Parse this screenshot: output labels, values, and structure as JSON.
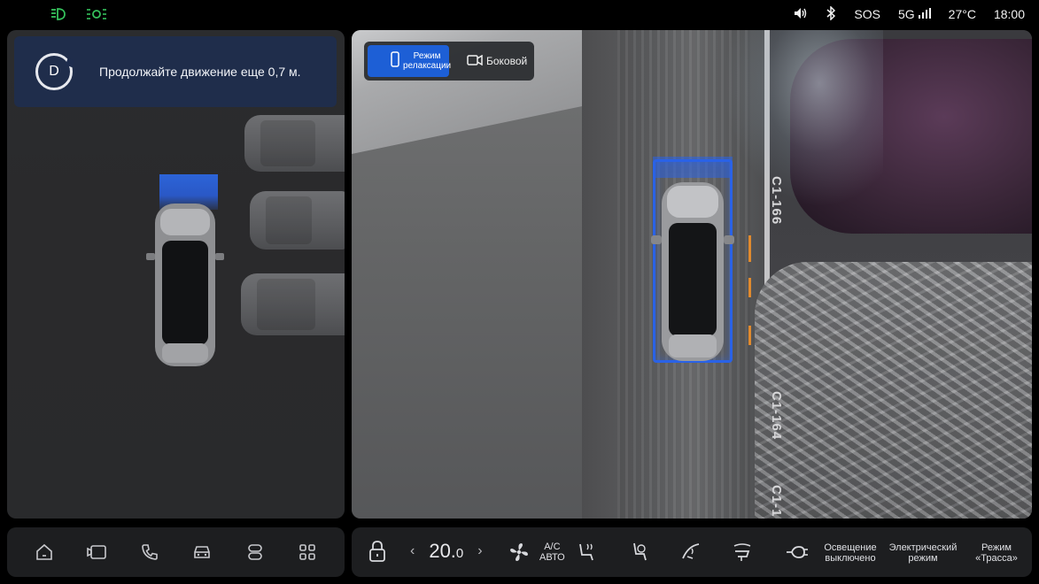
{
  "status_bar": {
    "sos": "SOS",
    "network": "5G",
    "temperature": "27°C",
    "time": "18:00",
    "left_icons": [
      "headlight-icon",
      "parking-light-icon"
    ],
    "accent_green": "#35c25c"
  },
  "notification": {
    "gear": "D",
    "message": "Продолжайте движение еще 0,7 м."
  },
  "camera": {
    "mode_relax_label_line1": "Режим",
    "mode_relax_label_line2": "релаксации",
    "mode_side_label": "Боковой",
    "bay_labels": [
      "C1-166",
      "C1-164",
      "C1-1"
    ],
    "accent_blue": "#1d5fd6"
  },
  "dock_left": {
    "icons": [
      "home-icon",
      "media-icon",
      "phone-icon",
      "car-icon",
      "toggle-icon",
      "apps-icon"
    ]
  },
  "dock_right": {
    "temperature_whole": "20.",
    "temperature_decimal": "0",
    "ac_line1": "A/C",
    "ac_line2": "АВТО",
    "lighting_line1": "Освещение",
    "lighting_line2": "выключено",
    "electric_line1": "Электрический",
    "electric_line2": "режим",
    "track_line1": "Режим",
    "track_line2": "«Трасса»"
  }
}
